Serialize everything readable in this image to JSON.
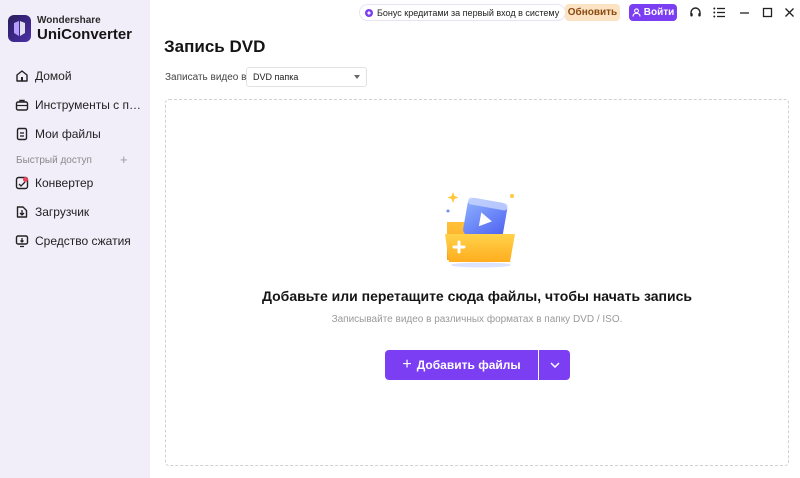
{
  "app": {
    "brand": "Wondershare",
    "product": "UniConverter"
  },
  "sidebar": {
    "items": [
      {
        "label": "Домой",
        "icon": "home-icon"
      },
      {
        "label": "Инструменты с под...",
        "icon": "toolbox-icon"
      },
      {
        "label": "Мои файлы",
        "icon": "file-icon"
      }
    ],
    "quick_access_label": "Быстрый доступ",
    "quick_items": [
      {
        "label": "Конвертер",
        "icon": "converter-icon"
      },
      {
        "label": "Загрузчик",
        "icon": "download-icon"
      },
      {
        "label": "Средство сжатия",
        "icon": "compress-icon"
      }
    ]
  },
  "topbar": {
    "promo_text": "Бонус кредитами за первый вход в систему",
    "update_label": "Обновить",
    "login_label": "Войти"
  },
  "main": {
    "title": "Запись DVD",
    "record_to_label": "Записать видео в:",
    "record_to_value": "DVD папка",
    "drop_title": "Добавьте или перетащите сюда файлы, чтобы начать запись",
    "drop_subtitle": "Записывайте видео в различных форматах в папку DVD / ISO.",
    "add_files_label": "Добавить файлы"
  },
  "colors": {
    "accent": "#7b3ef2",
    "sidebar_bg": "#f1eef9",
    "update_bg": "#fbe3c4"
  }
}
